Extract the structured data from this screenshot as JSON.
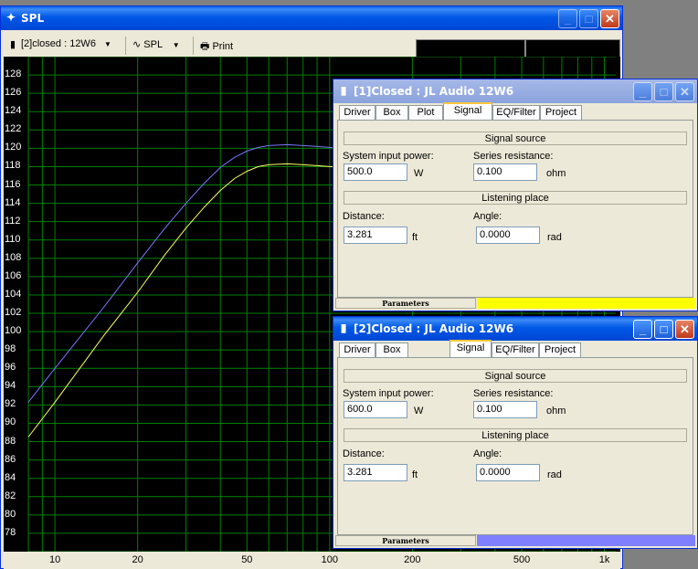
{
  "spl_window": {
    "title": "SPL",
    "toolbar": {
      "project_select": "[2]closed : 12W6",
      "graph_select": "SPL",
      "print_label": "Print"
    }
  },
  "chart_data": {
    "type": "line",
    "xscale": "log",
    "xlim": [
      8,
      1100
    ],
    "ylim": [
      76,
      130
    ],
    "y_ticks": [
      "128",
      "126",
      "124",
      "122",
      "120",
      "118",
      "116",
      "114",
      "112",
      "110",
      "108",
      "106",
      "104",
      "102",
      "100",
      "98",
      "96",
      "94",
      "92",
      "90",
      "88",
      "86",
      "84",
      "82",
      "80",
      "78"
    ],
    "x_ticks": [
      "10",
      "20",
      "50",
      "100",
      "200",
      "500",
      "1k"
    ],
    "grid": true,
    "series": [
      {
        "color": "#7878ff",
        "x": [
          8,
          10,
          15,
          20,
          25,
          30,
          35,
          40,
          45,
          50,
          55,
          60,
          70,
          80,
          90,
          100,
          110
        ],
        "y": [
          92.3,
          96.0,
          102.6,
          107.5,
          111.2,
          114.0,
          116.2,
          117.9,
          119.0,
          119.7,
          120.1,
          120.3,
          120.4,
          120.3,
          120.2,
          120.1,
          120.0
        ]
      },
      {
        "color": "#ffff66",
        "x": [
          8,
          10,
          15,
          20,
          25,
          30,
          35,
          40,
          45,
          50,
          55,
          60,
          70,
          80,
          90,
          100,
          110
        ],
        "y": [
          88.5,
          92.3,
          99.5,
          104.3,
          108.3,
          111.3,
          113.6,
          115.4,
          116.7,
          117.5,
          118.0,
          118.2,
          118.3,
          118.2,
          118.1,
          118.0,
          117.9
        ]
      }
    ]
  },
  "window1": {
    "title": "[1]Closed : JL Audio 12W6",
    "tabs": [
      "Driver",
      "Box",
      "Plot",
      "Signal",
      "EQ/Filter",
      "Project"
    ],
    "active_tab": "Signal",
    "signal_source": "Signal source",
    "power_label": "System input power:",
    "power_value": "500.0",
    "power_unit": "W",
    "resistance_label": "Series resistance:",
    "resistance_value": "0.100",
    "resistance_unit": "ohm",
    "listening_place": "Listening place",
    "distance_label": "Distance:",
    "distance_value": "3.281",
    "distance_unit": "ft",
    "angle_label": "Angle:",
    "angle_value": "0.0000",
    "angle_unit": "rad",
    "status_label": "Parameters",
    "status_color": "#ffff00"
  },
  "window2": {
    "title": "[2]Closed : JL Audio 12W6",
    "tabs": [
      "Driver",
      "Box",
      "Signal",
      "EQ/Filter",
      "Project"
    ],
    "active_tab": "Signal",
    "signal_source": "Signal source",
    "power_label": "System input power:",
    "power_value": "600.0",
    "power_unit": "W",
    "resistance_label": "Series resistance:",
    "resistance_value": "0.100",
    "resistance_unit": "ohm",
    "listening_place": "Listening place",
    "distance_label": "Distance:",
    "distance_value": "3.281",
    "distance_unit": "ft",
    "angle_label": "Angle:",
    "angle_value": "0.0000",
    "angle_unit": "rad",
    "status_label": "Parameters",
    "status_color": "#8080ff"
  }
}
